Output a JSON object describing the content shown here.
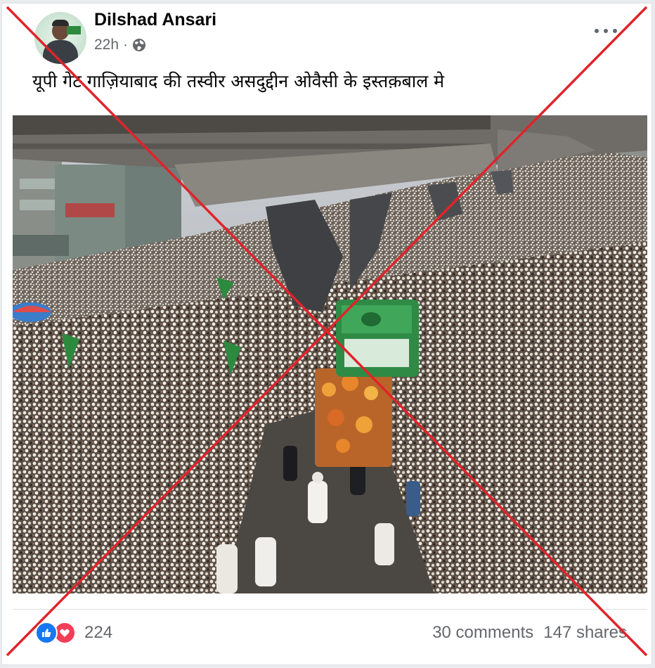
{
  "post": {
    "author": "Dilshad Ansari",
    "time": "22h",
    "separator": "·",
    "audience_icon": "globe-icon",
    "menu_icon": "more-horizontal-icon",
    "text": "यूपी गेट गाज़ियाबाद की तस्वीर असदुद्दीन ओवैसी के इस्तक़बाल मे"
  },
  "footer": {
    "reaction_icons": [
      "like-icon",
      "love-icon"
    ],
    "reaction_count": "224",
    "comments": "30 comments",
    "shares": "147 shares"
  },
  "overlay": {
    "mark": "red-x-icon",
    "color": "#e0232b"
  },
  "colors": {
    "like": "#1877f2",
    "love": "#f33e58",
    "secondary_text": "#65676b"
  }
}
